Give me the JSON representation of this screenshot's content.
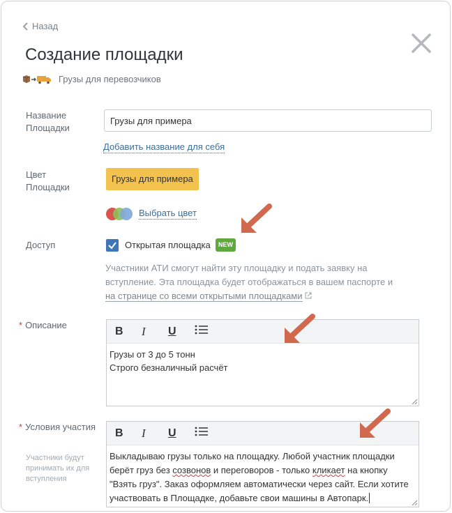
{
  "header": {
    "back_label": "Назад",
    "title": "Создание площадки",
    "subtitle": "Грузы для перевозчиков"
  },
  "name_field": {
    "label": "Название Площадки",
    "value": "Грузы для примера",
    "add_name_link": "Добавить название для себя"
  },
  "color_field": {
    "label": "Цвет Площадки",
    "chip_text": "Грузы для примера",
    "chip_color": "#f2c14e",
    "choose_link": "Выбрать цвет",
    "palette": [
      "#d9534f",
      "#8bbf5a",
      "#7fa7d9"
    ]
  },
  "access_field": {
    "label": "Доступ",
    "checkbox_label": "Открытая площадка",
    "checked": true,
    "badge": "NEW",
    "help_text": "Участники АТИ смогут найти эту площадку и подать заявку на вступление. Эта площадка будет отображаться в вашем паспорте и",
    "help_link": "на странице со всеми открытыми площадками"
  },
  "description_field": {
    "label": "Описание",
    "toolbar": {
      "bold": "B",
      "italic": "I",
      "underline": "U"
    },
    "lines": [
      "Грузы от 3 до 5 тонн",
      "Строго безналичный расчёт"
    ]
  },
  "conditions_field": {
    "label": "Условия участия",
    "hint": "Участники будут принимать их для вступления",
    "toolbar": {
      "bold": "B",
      "italic": "I",
      "underline": "U"
    },
    "text_part1": "Выкладываю грузы только на площадку. Любой участник площадки берёт груз без ",
    "word_calls": "созвонов",
    "text_part2": " и переговоров - только ",
    "word_clicks": "кликает",
    "text_part3": " на кнопку \"Взять груз\". Заказ оформляем автоматически через сайт. Если хотите участвовать в Площадке, добавьте свои машины в Автопарк."
  },
  "colors": {
    "accent_blue": "#3f76b8",
    "link_blue": "#3a6e9c",
    "required_red": "#c6433d",
    "arrow": "#d0694d",
    "new_badge": "#5fa83f"
  }
}
